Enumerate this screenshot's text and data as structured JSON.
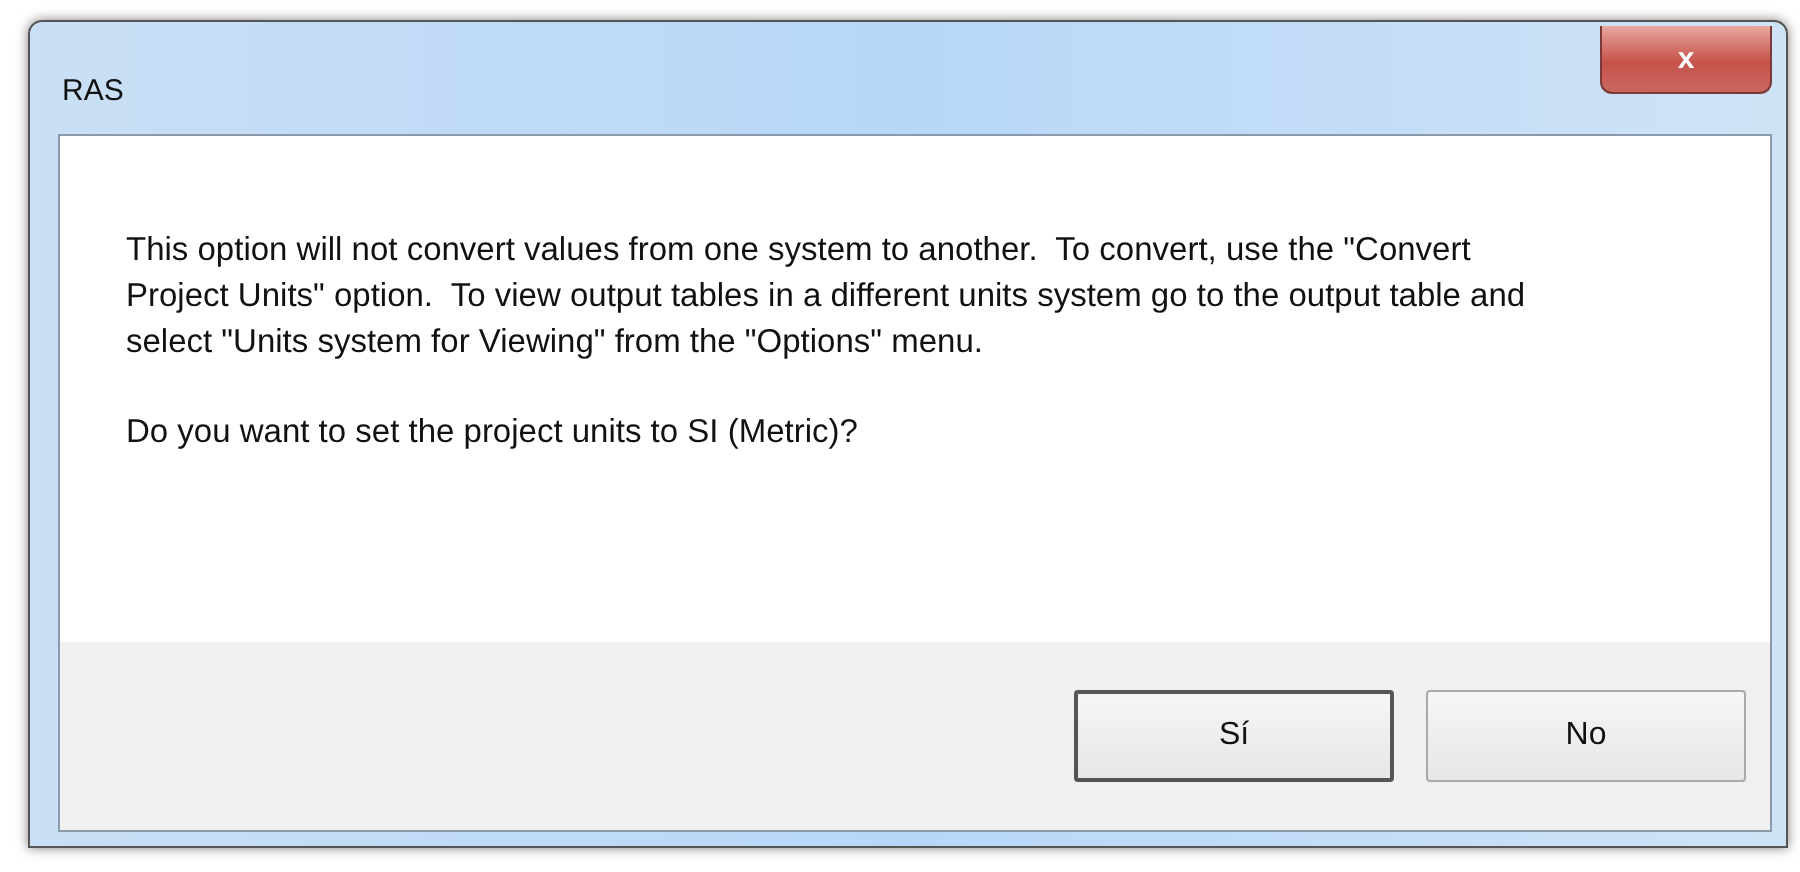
{
  "window": {
    "title": "RAS",
    "close_label": "x"
  },
  "message": [
    "This option will not convert values from one system to another.  To convert, use the \"Convert Project Units\" option.  To view output tables in a different units system go to the output table and select \"Units system for Viewing\" from the \"Options\" menu.",
    "Do you want to set the project units to SI (Metric)?"
  ],
  "buttons": [
    {
      "label": "Sí",
      "default": true
    },
    {
      "label": "No",
      "default": false
    }
  ]
}
